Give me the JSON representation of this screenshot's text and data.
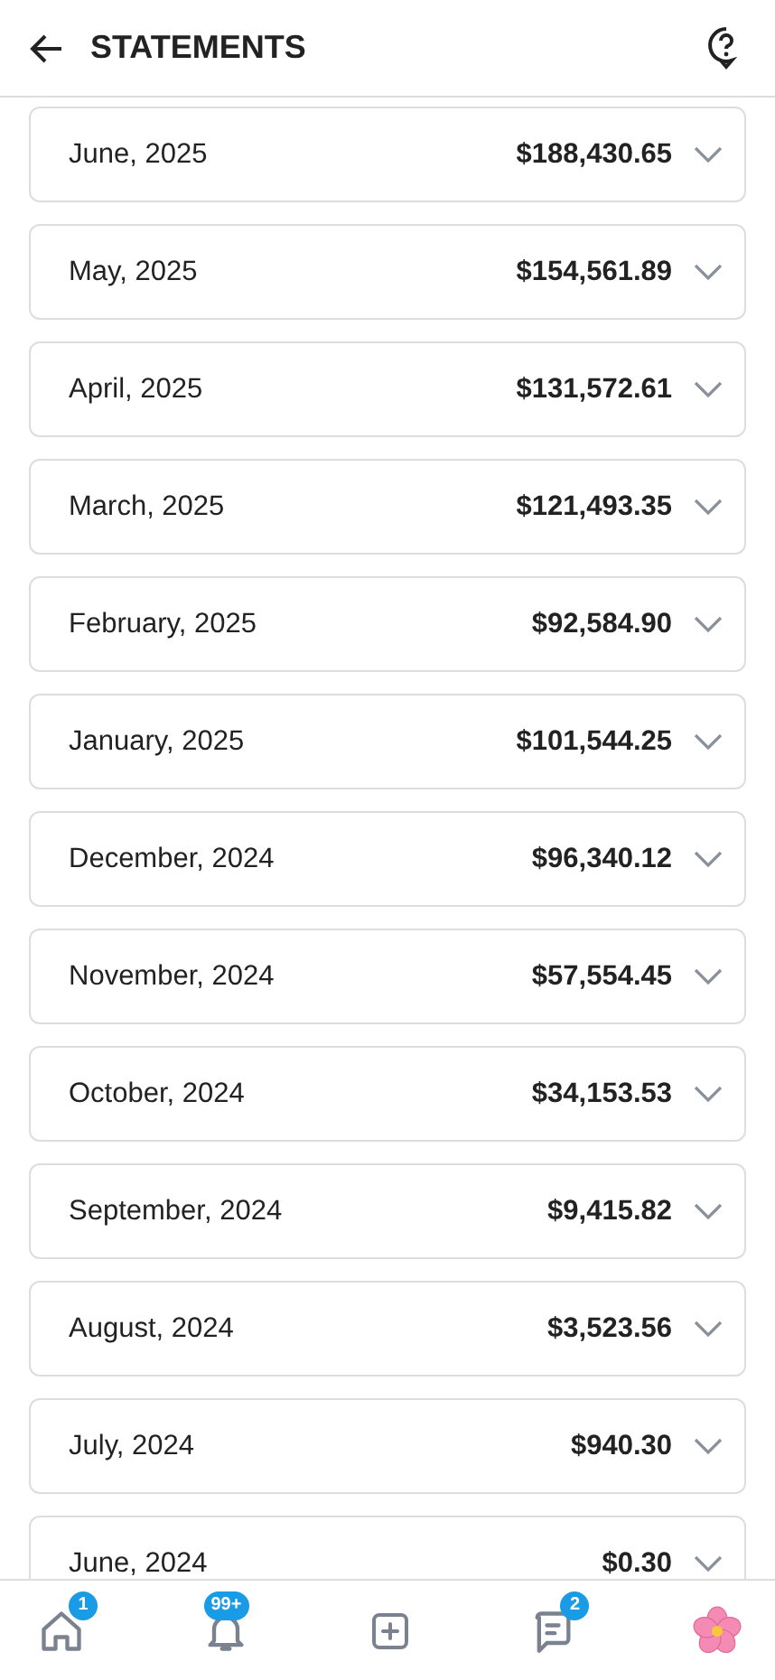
{
  "header": {
    "title": "STATEMENTS"
  },
  "statements": [
    {
      "month": "June, 2025",
      "amount": "$188,430.65",
      "expanded": false
    },
    {
      "month": "May, 2025",
      "amount": "$154,561.89",
      "expanded": false
    },
    {
      "month": "April, 2025",
      "amount": "$131,572.61",
      "expanded": false
    },
    {
      "month": "March, 2025",
      "amount": "$121,493.35",
      "expanded": false
    },
    {
      "month": "February, 2025",
      "amount": "$92,584.90",
      "expanded": false
    },
    {
      "month": "January, 2025",
      "amount": "$101,544.25",
      "expanded": false
    },
    {
      "month": "December, 2024",
      "amount": "$96,340.12",
      "expanded": false
    },
    {
      "month": "November, 2024",
      "amount": "$57,554.45",
      "expanded": false
    },
    {
      "month": "October, 2024",
      "amount": "$34,153.53",
      "expanded": false
    },
    {
      "month": "September, 2024",
      "amount": "$9,415.82",
      "expanded": false
    },
    {
      "month": "August, 2024",
      "amount": "$3,523.56",
      "expanded": false
    },
    {
      "month": "July, 2024",
      "amount": "$940.30",
      "expanded": false
    },
    {
      "month": "June, 2024",
      "amount": "$0.30",
      "expanded": false
    }
  ],
  "nav": [
    {
      "kind": "home",
      "badge": "1"
    },
    {
      "kind": "bell",
      "badge": "99+"
    },
    {
      "kind": "add"
    },
    {
      "kind": "chat",
      "badge": "2"
    },
    {
      "kind": "avatar"
    }
  ]
}
